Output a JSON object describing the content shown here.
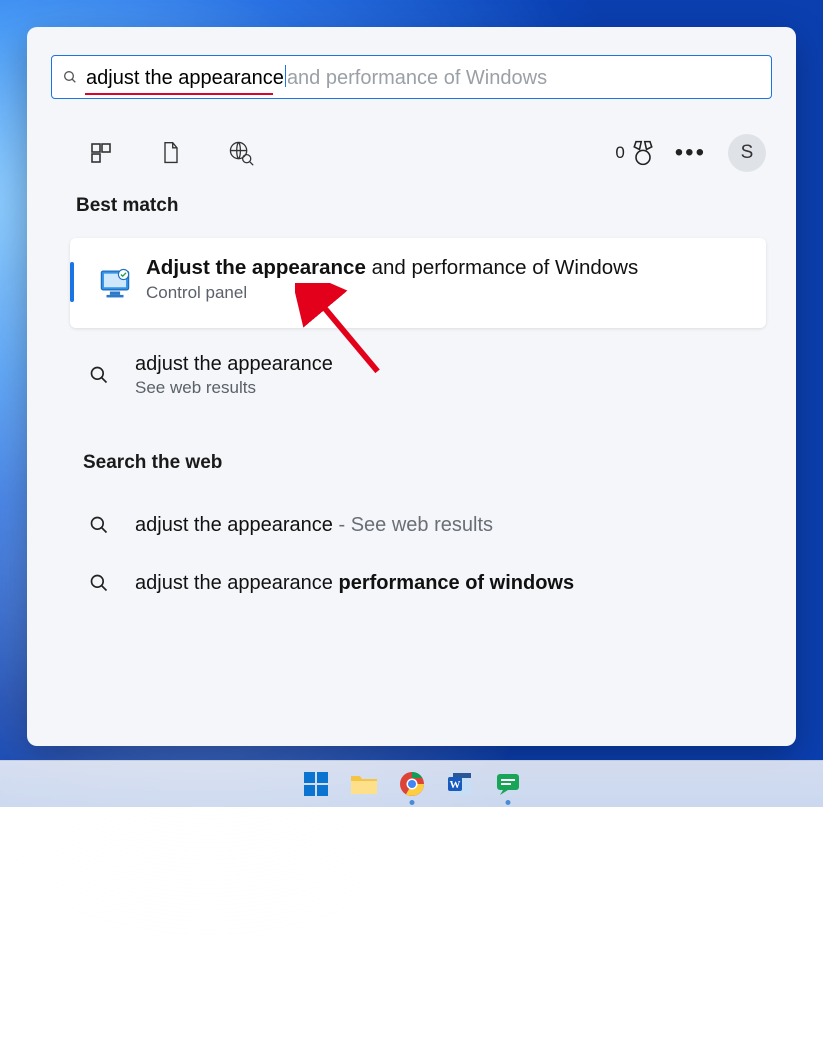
{
  "search": {
    "typed": "adjust the appearance",
    "ghost": "and performance of Windows"
  },
  "rewards": {
    "points": "0"
  },
  "avatar": {
    "initial": "S"
  },
  "sections": {
    "best_match": "Best match",
    "search_web": "Search the web"
  },
  "best_match": {
    "title_bold": "Adjust the appearance",
    "title_rest": " and performance of Windows",
    "subtitle": "Control panel"
  },
  "results": {
    "web1": {
      "line1": "adjust the appearance",
      "line2": "See web results"
    },
    "web2": {
      "prefix": "adjust the appearance",
      "suffix": " - See web results"
    },
    "web3": {
      "prefix": "adjust the appearance ",
      "bold": "performance of windows"
    }
  },
  "taskbar": {
    "start": "start-icon",
    "explorer": "file-explorer-icon",
    "chrome": "chrome-icon",
    "word": "word-icon",
    "chat": "chat-icon"
  }
}
